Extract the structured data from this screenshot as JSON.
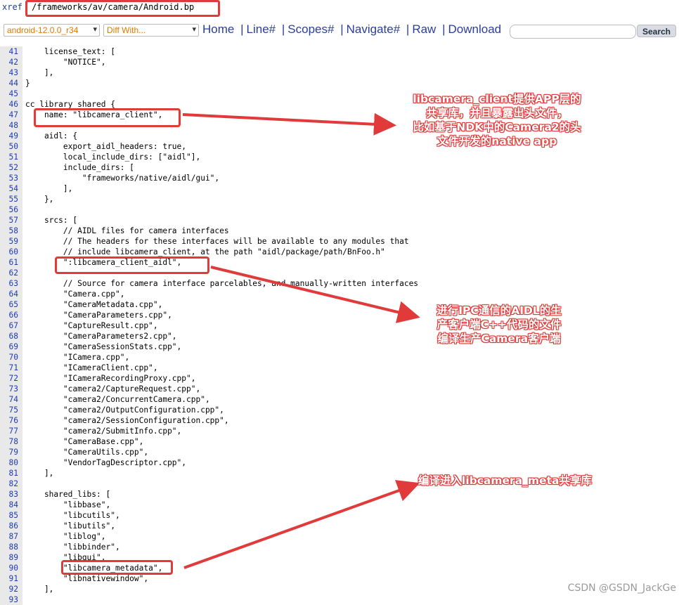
{
  "header": {
    "xref_label": "xref",
    "path": "/frameworks/av/camera/Android.bp"
  },
  "nav": {
    "version_select": "android-12.0.0_r34",
    "diff_select": "Diff With...",
    "links": [
      "Home",
      "Line#",
      "Scopes#",
      "Navigate#",
      "Raw",
      "Download"
    ],
    "search_placeholder": "",
    "search_button": "Search"
  },
  "code_lines": [
    {
      "n": "41",
      "t": "    license_text: ["
    },
    {
      "n": "42",
      "t": "        \"NOTICE\","
    },
    {
      "n": "43",
      "t": "    ],"
    },
    {
      "n": "44",
      "t": "}"
    },
    {
      "n": "45",
      "t": ""
    },
    {
      "n": "46",
      "t": "cc_library_shared {"
    },
    {
      "n": "47",
      "t": "    name: \"libcamera_client\","
    },
    {
      "n": "48",
      "t": ""
    },
    {
      "n": "49",
      "t": "    aidl: {"
    },
    {
      "n": "50",
      "t": "        export_aidl_headers: true,"
    },
    {
      "n": "51",
      "t": "        local_include_dirs: [\"aidl\"],"
    },
    {
      "n": "52",
      "t": "        include_dirs: ["
    },
    {
      "n": "53",
      "t": "            \"frameworks/native/aidl/gui\","
    },
    {
      "n": "54",
      "t": "        ],"
    },
    {
      "n": "55",
      "t": "    },"
    },
    {
      "n": "56",
      "t": ""
    },
    {
      "n": "57",
      "t": "    srcs: ["
    },
    {
      "n": "58",
      "t": "        // AIDL files for camera interfaces"
    },
    {
      "n": "59",
      "t": "        // The headers for these interfaces will be available to any modules that"
    },
    {
      "n": "60",
      "t": "        // include libcamera_client, at the path \"aidl/package/path/BnFoo.h\""
    },
    {
      "n": "61",
      "t": "        \":libcamera_client_aidl\","
    },
    {
      "n": "62",
      "t": ""
    },
    {
      "n": "63",
      "t": "        // Source for camera interface parcelables, and manually-written interfaces"
    },
    {
      "n": "64",
      "t": "        \"Camera.cpp\","
    },
    {
      "n": "65",
      "t": "        \"CameraMetadata.cpp\","
    },
    {
      "n": "66",
      "t": "        \"CameraParameters.cpp\","
    },
    {
      "n": "67",
      "t": "        \"CaptureResult.cpp\","
    },
    {
      "n": "68",
      "t": "        \"CameraParameters2.cpp\","
    },
    {
      "n": "69",
      "t": "        \"CameraSessionStats.cpp\","
    },
    {
      "n": "70",
      "t": "        \"ICamera.cpp\","
    },
    {
      "n": "71",
      "t": "        \"ICameraClient.cpp\","
    },
    {
      "n": "72",
      "t": "        \"ICameraRecordingProxy.cpp\","
    },
    {
      "n": "73",
      "t": "        \"camera2/CaptureRequest.cpp\","
    },
    {
      "n": "74",
      "t": "        \"camera2/ConcurrentCamera.cpp\","
    },
    {
      "n": "75",
      "t": "        \"camera2/OutputConfiguration.cpp\","
    },
    {
      "n": "76",
      "t": "        \"camera2/SessionConfiguration.cpp\","
    },
    {
      "n": "77",
      "t": "        \"camera2/SubmitInfo.cpp\","
    },
    {
      "n": "78",
      "t": "        \"CameraBase.cpp\","
    },
    {
      "n": "79",
      "t": "        \"CameraUtils.cpp\","
    },
    {
      "n": "80",
      "t": "        \"VendorTagDescriptor.cpp\","
    },
    {
      "n": "81",
      "t": "    ],"
    },
    {
      "n": "82",
      "t": ""
    },
    {
      "n": "83",
      "t": "    shared_libs: ["
    },
    {
      "n": "84",
      "t": "        \"libbase\","
    },
    {
      "n": "85",
      "t": "        \"libcutils\","
    },
    {
      "n": "86",
      "t": "        \"libutils\","
    },
    {
      "n": "87",
      "t": "        \"liblog\","
    },
    {
      "n": "88",
      "t": "        \"libbinder\","
    },
    {
      "n": "89",
      "t": "        \"libgui\","
    },
    {
      "n": "90",
      "t": "        \"libcamera_metadata\","
    },
    {
      "n": "91",
      "t": "        \"libnativewindow\","
    },
    {
      "n": "92",
      "t": "    ],"
    },
    {
      "n": "93",
      "t": ""
    }
  ],
  "annotations": {
    "note1": [
      "libcamera_client提供APP层的",
      "共享库，并且暴露出头文件，",
      "比如基于NDK中的Camera2的头",
      "文件开发的native app"
    ],
    "note2": [
      "进行IPC通信的AIDL的生",
      "产客户端C++代码的文件",
      "编译生产Camera客户端"
    ],
    "note3": [
      "编译进入libcamera_meta共享库"
    ]
  },
  "colors": {
    "annotation": "#e03a3a",
    "link": "#2a3e9c",
    "line_number": "#1d3bb8"
  },
  "watermark": "CSDN @GSDN_JackGe"
}
